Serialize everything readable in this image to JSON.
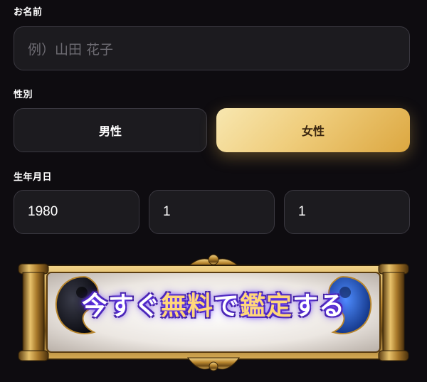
{
  "form": {
    "name_label": "お名前",
    "name_placeholder": "例）山田 花子",
    "gender_label": "性別",
    "gender_options": [
      "男性",
      "女性"
    ],
    "gender_selected": "女性",
    "birth_label": "生年月日",
    "birth_year": "1980",
    "birth_month": "1",
    "birth_day": "1"
  },
  "cta": {
    "part1": "今すぐ",
    "part2": "無料",
    "part3": "で",
    "part4": "鑑定",
    "part5": "する"
  },
  "colors": {
    "background": "#0e0c10",
    "field_bg": "#1c1b1f",
    "selected_gold": "#efcd7c",
    "cta_glow": "#6a3cff"
  }
}
